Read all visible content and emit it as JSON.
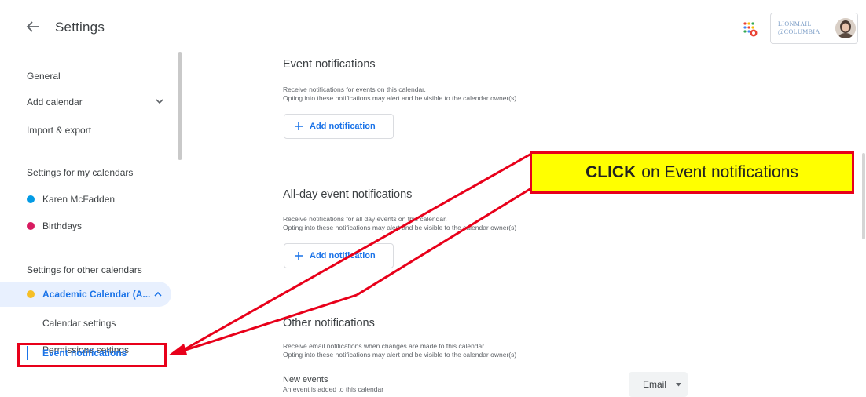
{
  "header": {
    "title": "Settings",
    "brand_line1": "LIONMAIL",
    "brand_line2": "@COLUMBIA"
  },
  "sidebar": {
    "general": "General",
    "add_calendar": "Add calendar",
    "import_export": "Import & export",
    "section_my": "Settings for my calendars",
    "my_calendars": [
      {
        "label": "Karen McFadden",
        "color": "#039be5"
      },
      {
        "label": "Birthdays",
        "color": "#d81b60"
      }
    ],
    "section_other": "Settings for other calendars",
    "active_calendar": {
      "label": "Academic Calendar (A...",
      "color": "#f6bf26"
    },
    "sub_items": [
      "Calendar settings",
      "Permissions settings"
    ],
    "active_sub_item": "Event notifications"
  },
  "main": {
    "event_notifications": {
      "title": "Event notifications",
      "desc1": "Receive notifications for events on this calendar.",
      "desc2": "Opting into these notifications may alert and be visible to the calendar owner(s)",
      "button": "Add notification"
    },
    "allday_notifications": {
      "title": "All-day event notifications",
      "desc1": "Receive notifications for all day events on this calendar.",
      "desc2": "Opting into these notifications may alert and be visible to the calendar owner(s)",
      "button": "Add notification"
    },
    "other_notifications": {
      "title": "Other notifications",
      "desc1": "Receive email notifications when changes are made to this calendar.",
      "desc2": "Opting into these notifications may alert and be visible to the calendar owner(s)",
      "new_events": "New events",
      "new_events_desc": "An event is added to this calendar",
      "email_select": "Email"
    }
  },
  "callout": {
    "bold": "CLICK",
    "text": "on Event notifications"
  },
  "colors": {
    "accent": "#1a73e8",
    "highlight_border": "#e8001a",
    "callout_fill": "#ffff00"
  }
}
